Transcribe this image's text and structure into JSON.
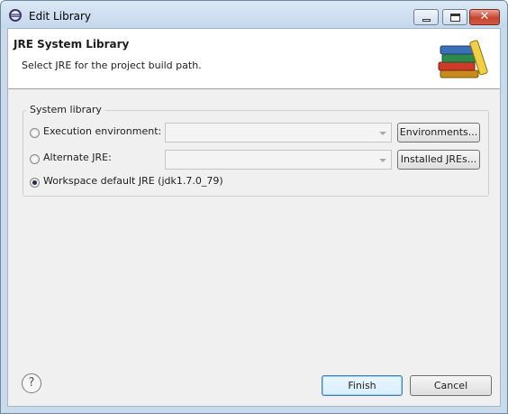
{
  "window": {
    "title": "Edit Library",
    "controls": {
      "minimize_icon": "minimize-icon",
      "maximize_icon": "maximize-icon",
      "close_icon": "close-icon",
      "close_glyph": "✕"
    }
  },
  "banner": {
    "title": "JRE System Library",
    "description": "Select JRE for the project build path.",
    "image": "library-books-icon"
  },
  "group": {
    "title": "System library",
    "options": [
      {
        "label": "Execution environment:",
        "checked": false,
        "combo_value": "",
        "button": "Environments..."
      },
      {
        "label": "Alternate JRE:",
        "checked": false,
        "combo_value": "",
        "button": "Installed JREs..."
      },
      {
        "label": "Workspace default JRE (jdk1.7.0_79)",
        "checked": true
      }
    ]
  },
  "footer": {
    "help_glyph": "?",
    "finish": "Finish",
    "cancel": "Cancel"
  }
}
